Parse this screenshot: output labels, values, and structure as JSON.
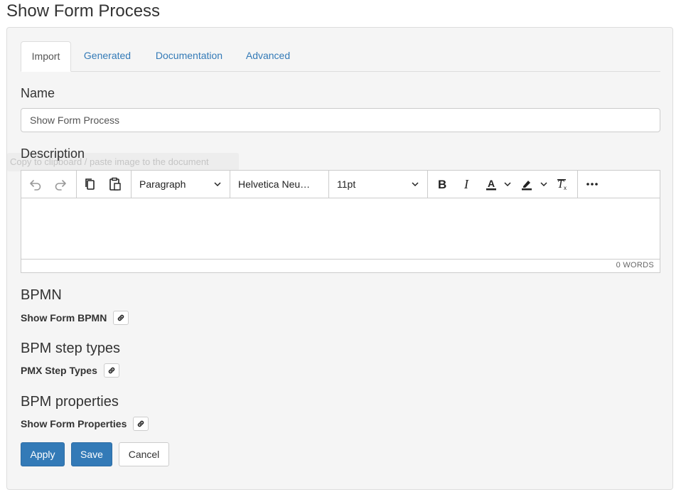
{
  "page": {
    "title": "Show Form Process"
  },
  "tabs": [
    {
      "label": "Import",
      "active": true
    },
    {
      "label": "Generated",
      "active": false
    },
    {
      "label": "Documentation",
      "active": false
    },
    {
      "label": "Advanced",
      "active": false
    }
  ],
  "name_field": {
    "label": "Name",
    "value": "Show Form Process"
  },
  "description": {
    "label": "Description",
    "tooltip_ghost": "Copy to clipboard / paste image to the document",
    "toolbar": {
      "undo_icon": "undo-icon",
      "redo_icon": "redo-icon",
      "copy_icon": "copy-icon",
      "paste_icon": "paste-icon",
      "block_format": "Paragraph",
      "font_family": "Helvetica Neu…",
      "font_size": "11pt",
      "more_icon": "more-icon"
    },
    "word_count": "0 WORDS"
  },
  "sections": {
    "bpmn": {
      "heading": "BPMN",
      "link_label": "Show Form BPMN"
    },
    "step_types": {
      "heading": "BPM step types",
      "link_label": "PMX Step Types"
    },
    "properties": {
      "heading": "BPM properties",
      "link_label": "Show Form Properties"
    }
  },
  "actions": {
    "apply": "Apply",
    "save": "Save",
    "cancel": "Cancel"
  },
  "colors": {
    "primary": "#337ab7",
    "panel_bg": "#f5f5f5",
    "border": "#dddddd"
  }
}
